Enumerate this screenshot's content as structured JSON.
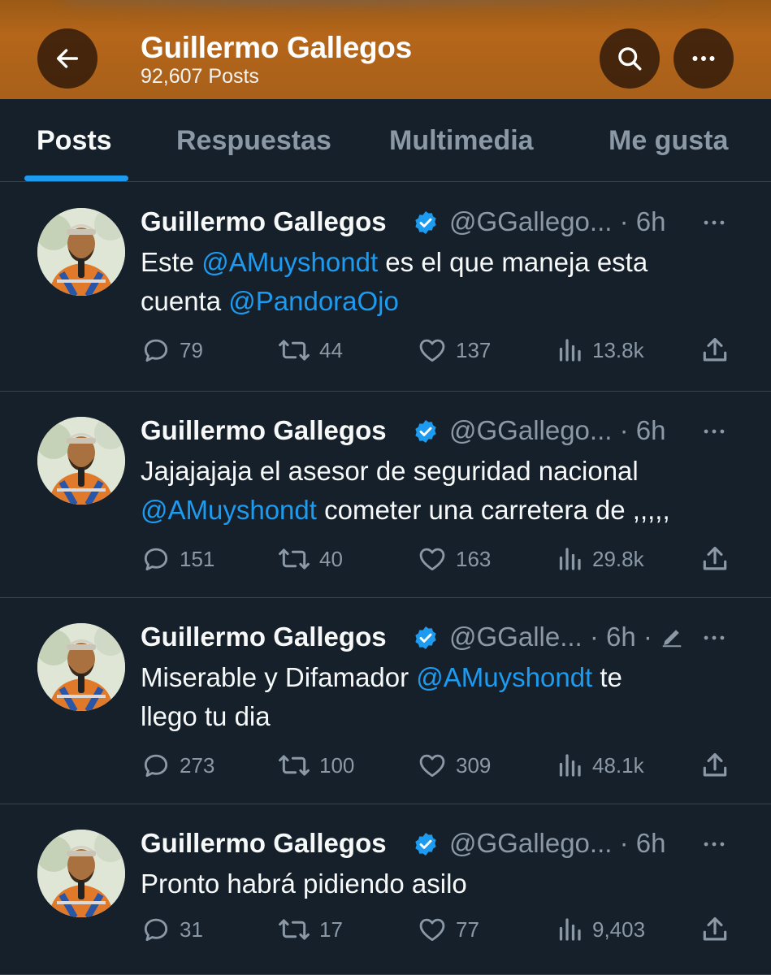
{
  "header": {
    "title": "Guillermo Gallegos",
    "subtitle": "92,607 Posts"
  },
  "tabs": [
    "Posts",
    "Respuestas",
    "Multimedia",
    "Me gusta"
  ],
  "colors": {
    "background": "#15202b",
    "accent": "#1d9bf0",
    "muted": "#8b98a5",
    "header_bg": "#a8601a"
  },
  "posts": [
    {
      "name": "Guillermo Gallegos",
      "handle": "@GGallego...",
      "sep": "·",
      "time": "6h",
      "line1_a": "Este ",
      "line1_mention": "@AMuyshondt",
      "line1_b": "  es el que maneja esta",
      "line2_a": "cuenta ",
      "line2_mention": "@PandoraOjo",
      "line2_b": "",
      "replies": "79",
      "reposts": "44",
      "likes": "137",
      "views": "13.8k"
    },
    {
      "name": "Guillermo Gallegos",
      "handle": "@GGallego...",
      "sep": "·",
      "time": "6h",
      "line1_a": "Jajajajaja  el asesor de seguridad nacional",
      "line1_mention": "",
      "line1_b": "",
      "line2_a": "",
      "line2_mention": "@AMuyshondt",
      "line2_b": "  cometer una carretera de ,,,,,",
      "replies": "151",
      "reposts": "40",
      "likes": "163",
      "views": "29.8k"
    },
    {
      "name": "Guillermo Gallegos",
      "handle": "@GGalle...",
      "sep": "·",
      "time": "6h",
      "sep2": "·",
      "line1_a": "Miserable  y  Difamador  ",
      "line1_mention": "@AMuyshondt",
      "line1_b": " te",
      "line2_a": "llego tu dia",
      "line2_mention": "",
      "line2_b": "",
      "replies": "273",
      "reposts": "100",
      "likes": "309",
      "views": "48.1k"
    },
    {
      "name": "Guillermo Gallegos",
      "handle": "@GGallego...",
      "sep": "·",
      "time": "6h",
      "line1_a": "Pronto habrá  pidiendo asilo",
      "line1_mention": "",
      "line1_b": "",
      "line2_a": "",
      "line2_mention": "",
      "line2_b": "",
      "replies": "31",
      "reposts": "17",
      "likes": "77",
      "views": "9,403"
    }
  ],
  "icons": {
    "back": "arrow-left-icon",
    "search": "search-icon",
    "more": "more-horizontal-icon",
    "verified": "verified-badge-icon",
    "reply": "reply-icon",
    "repost": "repost-icon",
    "like": "heart-icon",
    "views": "views-icon",
    "share": "share-icon",
    "edit": "edited-pencil-icon"
  }
}
